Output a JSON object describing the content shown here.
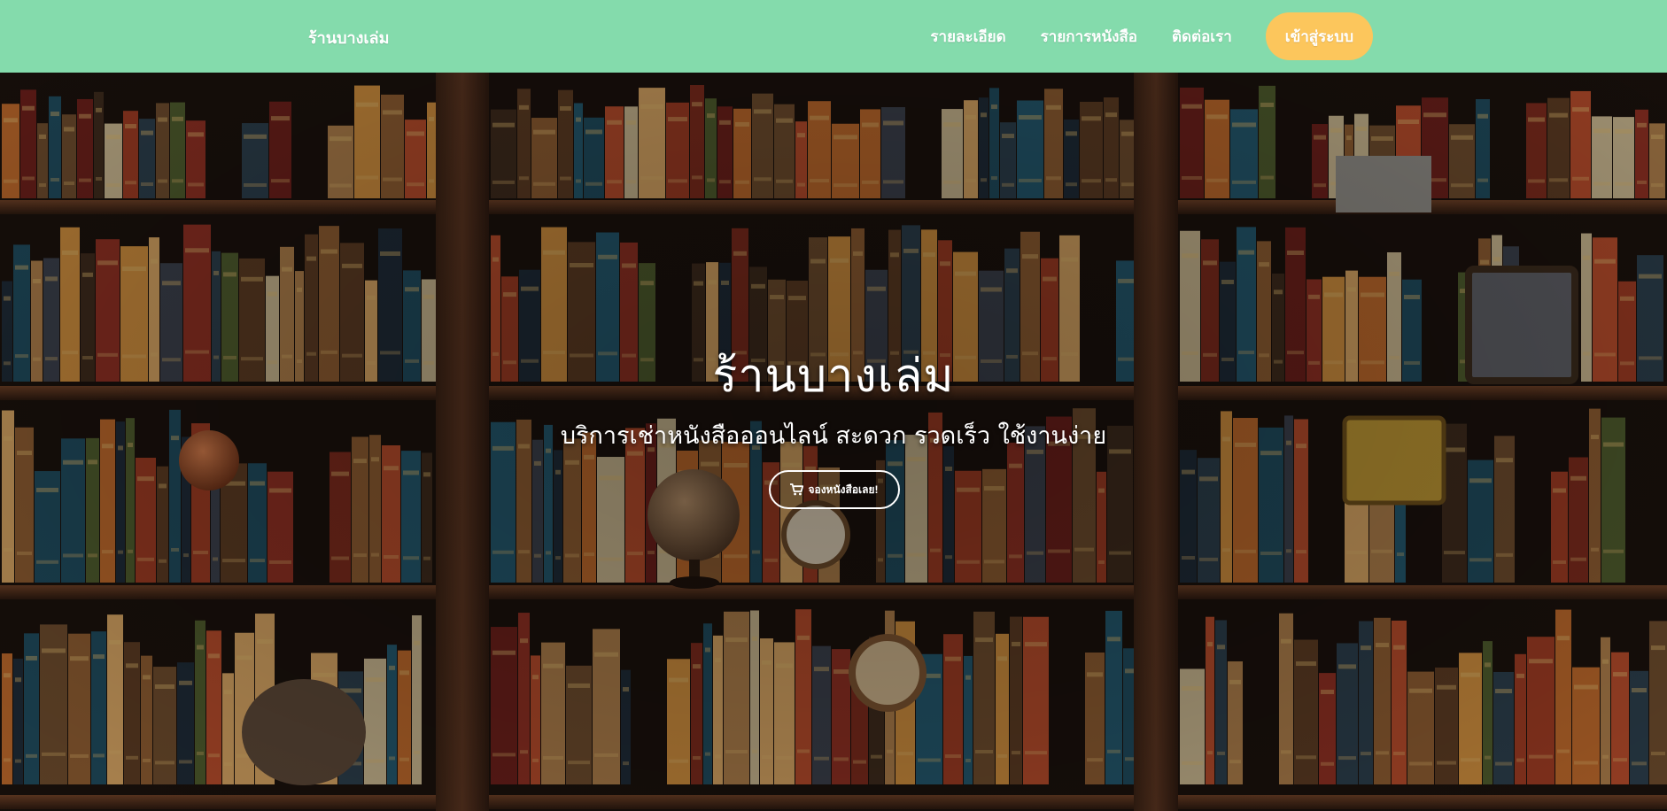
{
  "navbar": {
    "brand": "ร้านบางเล่ม",
    "links": [
      {
        "label": "รายละเอียด"
      },
      {
        "label": "รายการหนังสือ"
      },
      {
        "label": "ติดต่อเรา"
      }
    ],
    "login_label": "เข้าสู่ระบบ",
    "colors": {
      "background": "#84dbac",
      "login_button": "#fcc65c",
      "text": "#ffffff"
    }
  },
  "hero": {
    "title": "ร้านบางเล่ม",
    "subtitle": "บริการเช่าหนังสือออนไลน์ สะดวก รวดเร็ว ใช้งานง่าย",
    "cta": {
      "icon": "cart-icon",
      "label": "จองหนังสือเลย!"
    },
    "background": "bookshelf-photo"
  }
}
